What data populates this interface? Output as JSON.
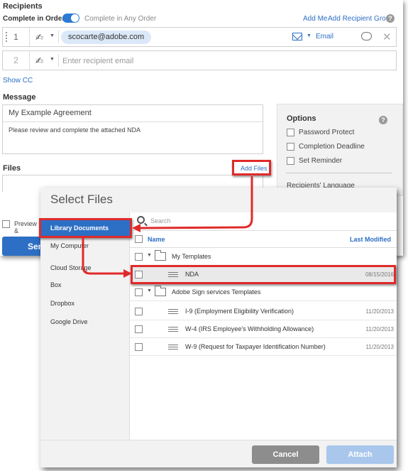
{
  "recipients": {
    "title": "Recipients",
    "complete_in_order": "Complete in Order",
    "complete_any_order": "Complete in Any Order",
    "add_me": "Add Me",
    "add_recipient_group": "Add Recipient Group",
    "rows": [
      {
        "number": "1",
        "email": "scocarte@adobe.com",
        "delivery": "Email"
      },
      {
        "number": "2",
        "placeholder": "Enter recipient email"
      }
    ],
    "show_cc": "Show CC"
  },
  "message": {
    "title": "Message",
    "subject": "My Example Agreement",
    "body": "Please review and complete the attached NDA"
  },
  "options": {
    "title": "Options",
    "items": [
      "Password Protect",
      "Completion Deadline",
      "Set Reminder"
    ],
    "recipients_language": "Recipients' Language"
  },
  "files": {
    "title": "Files",
    "add_files": "Add Files",
    "preview_partial": "Preview &",
    "send_partial": "Sen"
  },
  "dialog": {
    "title": "Select Files",
    "sources": [
      "Library Documents",
      "My Computer",
      "Cloud Storage",
      "Box",
      "Dropbox",
      "Google Drive"
    ],
    "search_placeholder": "Search",
    "col_name": "Name",
    "col_modified": "Last Modified",
    "rows": [
      {
        "type": "folder",
        "name": "My Templates",
        "date": ""
      },
      {
        "type": "document",
        "name": "NDA",
        "date": "08/15/2016",
        "highlighted": true
      },
      {
        "type": "folder",
        "name": "Adobe Sign services Templates",
        "date": ""
      },
      {
        "type": "document",
        "name": "I-9 (Employment Eligibility Verification)",
        "date": "11/20/2013"
      },
      {
        "type": "document",
        "name": "W-4 (IRS Employee's Withholding Allowance)",
        "date": "11/20/2013"
      },
      {
        "type": "document",
        "name": "W-9 (Request for Taxpayer Identification Number)",
        "date": "11/20/2013"
      }
    ],
    "cancel": "Cancel",
    "attach": "Attach"
  },
  "colors": {
    "accent": "#2d6fc4",
    "annotation": "#e02a2a",
    "panel": "#f2f2f2"
  },
  "icons": [
    "grip-icon",
    "pen-icon",
    "mail-icon",
    "chat-icon",
    "close-icon",
    "help-icon",
    "search-icon",
    "folder-icon",
    "document-icon"
  ]
}
